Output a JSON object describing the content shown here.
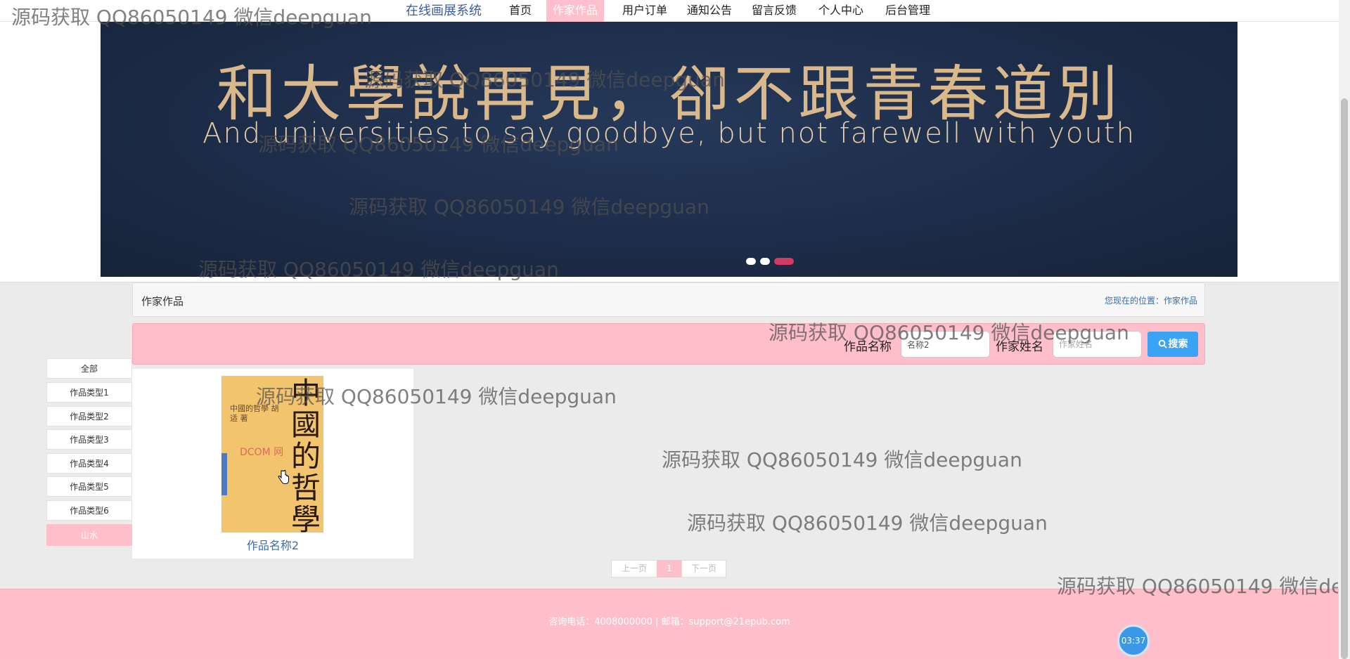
{
  "nav": {
    "brand": "在线画展系统",
    "items": [
      {
        "label": "首页"
      },
      {
        "label": "作家作品"
      },
      {
        "label": "用户订单"
      },
      {
        "label": "通知公告"
      },
      {
        "label": "留言反馈"
      },
      {
        "label": "个人中心"
      },
      {
        "label": "后台管理"
      }
    ],
    "active_index": 1
  },
  "banner": {
    "title": "和大學說再見，卻不跟青春道別",
    "subtitle": "And universities to say goodbye, but not farewell with youth",
    "slide_count": 3,
    "active_slide": 2
  },
  "breadcrumb": {
    "title": "作家作品",
    "location": "您现在的位置：作家作品"
  },
  "search": {
    "name_label": "作品名称",
    "name_value": "名称2",
    "author_label": "作家姓名",
    "author_placeholder": "作家姓名",
    "button_label": "搜索"
  },
  "categories": [
    {
      "label": "全部"
    },
    {
      "label": "作品类型1"
    },
    {
      "label": "作品类型2"
    },
    {
      "label": "作品类型3"
    },
    {
      "label": "作品类型4"
    },
    {
      "label": "作品类型5"
    },
    {
      "label": "作品类型6"
    },
    {
      "label": "山水"
    }
  ],
  "active_category_index": 7,
  "products": [
    {
      "name": "作品名称2",
      "cover_title": "中國的哲學",
      "cover_text": "中國的哲學 胡适 著",
      "cover_badge": "DCOM 网"
    }
  ],
  "pagination": {
    "prev_label": "上一页",
    "current": "1",
    "next_label": "下一页"
  },
  "footer": {
    "text": "咨询电话：4008000000 | 邮箱：support@21epub.com"
  },
  "timer": "03:37",
  "watermark": "源码获取 QQ86050149 微信deepguan",
  "colors": {
    "accent_pink": "#ffbfca",
    "link_blue": "#3b6ea3",
    "search_button": "#3aa3f5",
    "banner_bg": "#1d2c48",
    "banner_text": "#d9b88c"
  }
}
